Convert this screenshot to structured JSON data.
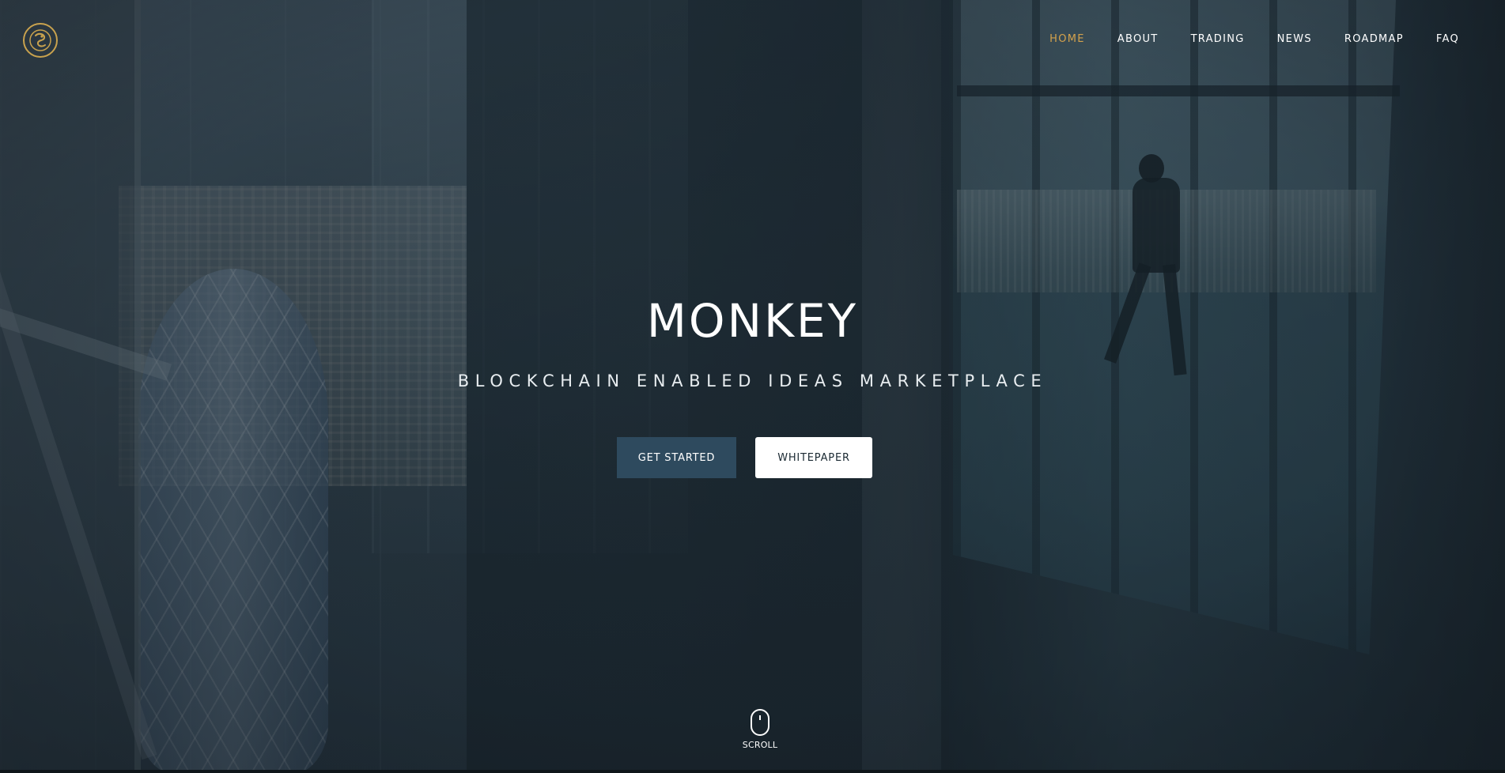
{
  "brand": {
    "logo_icon": "monkey-logo-icon",
    "accent_color": "#d4a24c"
  },
  "nav": {
    "items": [
      {
        "label": "HOME",
        "active": true
      },
      {
        "label": "ABOUT",
        "active": false
      },
      {
        "label": "TRADING",
        "active": false
      },
      {
        "label": "NEWS",
        "active": false
      },
      {
        "label": "ROADMAP",
        "active": false
      },
      {
        "label": "FAQ",
        "active": false
      }
    ]
  },
  "hero": {
    "title": "MONKEY",
    "subtitle": "BLOCKCHAIN ENABLED IDEAS MARKETPLACE",
    "primary_button": "GET STARTED",
    "secondary_button": "WHITEPAPER",
    "primary_button_color": "#2e4a5e"
  },
  "scroll": {
    "icon": "mouse-icon",
    "label": "SCROLL"
  }
}
